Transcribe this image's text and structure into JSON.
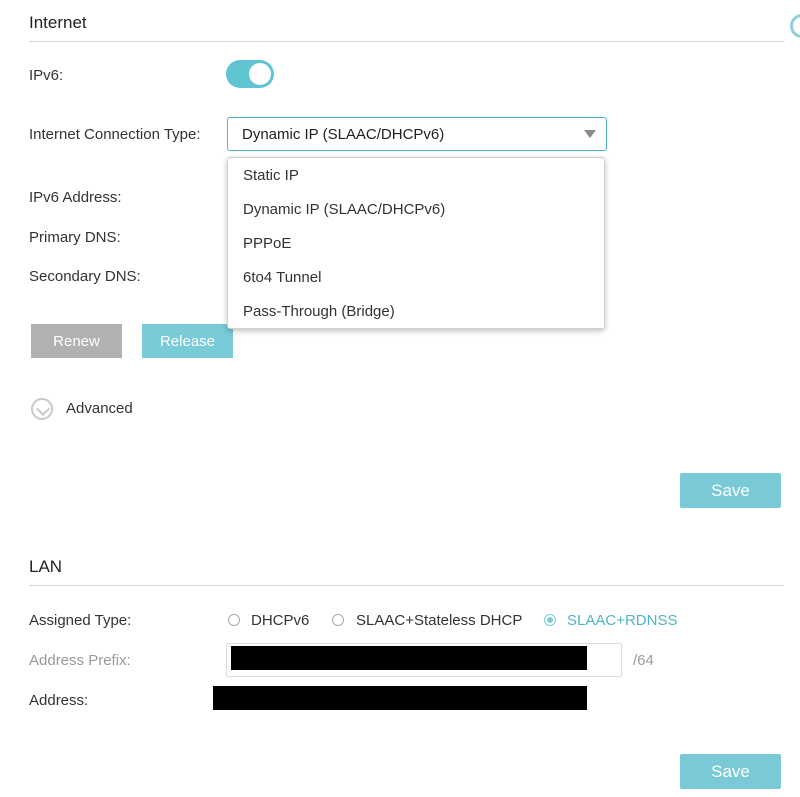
{
  "internet": {
    "title": "Internet",
    "ipv6_label": "IPv6:",
    "ipv6_enabled": true,
    "connection_type_label": "Internet Connection Type:",
    "connection_type_value": "Dynamic IP (SLAAC/DHCPv6)",
    "connection_type_options": [
      "Static IP",
      "Dynamic IP (SLAAC/DHCPv6)",
      "PPPoE",
      "6to4 Tunnel",
      "Pass-Through (Bridge)"
    ],
    "ipv6_address_label": "IPv6 Address:",
    "primary_dns_label": "Primary DNS:",
    "secondary_dns_label": "Secondary DNS:",
    "renew_label": "Renew",
    "release_label": "Release",
    "advanced_label": "Advanced",
    "save_label": "Save"
  },
  "lan": {
    "title": "LAN",
    "assigned_type_label": "Assigned Type:",
    "assigned_type_options": [
      "DHCPv6",
      "SLAAC+Stateless DHCP",
      "SLAAC+RDNSS"
    ],
    "assigned_type_selected": "SLAAC+RDNSS",
    "address_prefix_label": "Address Prefix:",
    "prefix_suffix": "/64",
    "address_label": "Address:",
    "save_label": "Save"
  },
  "colors": {
    "accent": "#4db6c8",
    "toggle_on": "#5fc4d2",
    "save_button": "#79cad6",
    "release_button": "#78cbd7",
    "renew_button": "#b1b1b1"
  },
  "icons": {
    "advanced": "chevron-down-circle-icon",
    "select_caret": "caret-down-icon",
    "edge": "circle-icon"
  }
}
